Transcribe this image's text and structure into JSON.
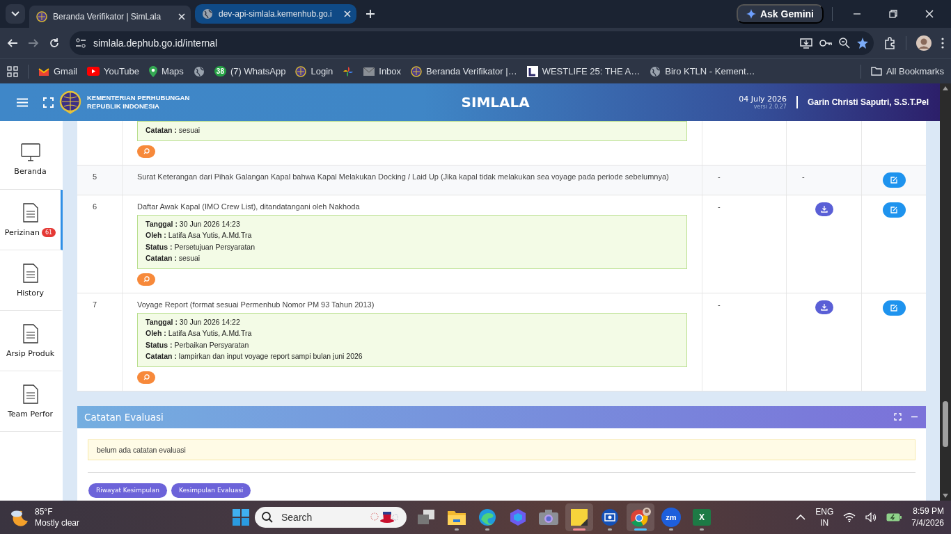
{
  "browser": {
    "tabs": [
      {
        "title": "Beranda Verifikator | SimLala",
        "kind": "emblem",
        "selected": true
      },
      {
        "title": "dev-api-simlala.kemenhub.go.i",
        "kind": "globe",
        "selected": false
      }
    ],
    "ask_gemini": "Ask Gemini",
    "url": "simlala.dephub.go.id/internal",
    "bookmarks": [
      {
        "kind": "gmail",
        "label": "Gmail"
      },
      {
        "kind": "youtube",
        "label": "YouTube"
      },
      {
        "kind": "maps",
        "label": "Maps"
      },
      {
        "kind": "globe"
      },
      {
        "kind": "whatsapp",
        "badge": "38",
        "label": "(7) WhatsApp"
      },
      {
        "kind": "emblem",
        "label": "Login"
      },
      {
        "kind": "pinwheel"
      },
      {
        "kind": "mail",
        "label": "Inbox"
      },
      {
        "kind": "emblem",
        "label": "Beranda Verifikator |…"
      },
      {
        "kind": "square",
        "label": "WESTLIFE 25: THE A…"
      },
      {
        "kind": "globe",
        "label": "Biro KTLN - Kement…"
      }
    ],
    "all_bookmarks": "All Bookmarks"
  },
  "app_header": {
    "ministry": [
      "KEMENTERIAN PERHUBUNGAN",
      "REPUBLIK INDONESIA"
    ],
    "title": "SIMLALA",
    "date": "04 July 2026",
    "version": "versi 2.0.27",
    "user": "Garin Christi Saputri, S.S.T.Pel"
  },
  "sidebar": {
    "items": [
      {
        "kind": "monitor",
        "label": "Beranda",
        "selected": false
      },
      {
        "kind": "document",
        "label": "Perizinan",
        "badge": "61",
        "selected": true
      },
      {
        "kind": "document",
        "label": "History",
        "selected": false
      },
      {
        "kind": "document",
        "label": "Arsip Produk",
        "selected": false
      },
      {
        "kind": "document",
        "label": "Team Perfor",
        "selected": false
      }
    ]
  },
  "table": {
    "rows": [
      {
        "notes": [
          {
            "label": "Catatan :",
            "value": "sesuai"
          }
        ],
        "view_button": true,
        "download": false,
        "edit": false
      },
      {
        "no": "5",
        "document": "Surat Keterangan dari Pihak Galangan Kapal bahwa Kapal Melakukan Docking / Laid Up (Jika kapal tidak melakukan sea voyage pada periode sebelumnya)",
        "column_3": "-",
        "column_4": "-",
        "view_button": false,
        "download": false,
        "edit": true
      },
      {
        "no": "6",
        "document": "Daftar Awak Kapal (IMO Crew List), ditandatangani oleh Nakhoda",
        "notes": [
          {
            "label": "Tanggal :",
            "value": "30 Jun 2026 14:23"
          },
          {
            "label": "Oleh :",
            "value": "Latifa Asa Yutis, A.Md.Tra"
          },
          {
            "label": "Status :",
            "value": "Persetujuan Persyaratan"
          },
          {
            "label": "Catatan :",
            "value": "sesuai"
          }
        ],
        "column_3": "-",
        "view_button": true,
        "download": true,
        "edit": true
      },
      {
        "no": "7",
        "document": "Voyage Report (format sesuai Permenhub Nomor PM 93 Tahun 2013)",
        "notes": [
          {
            "label": "Tanggal :",
            "value": "30 Jun 2026 14:22"
          },
          {
            "label": "Oleh :",
            "value": "Latifa Asa Yutis, A.Md.Tra"
          },
          {
            "label": "Status :",
            "value": "Perbaikan Persyaratan"
          },
          {
            "label": "Catatan :",
            "value": "lampirkan dan input voyage report sampi bulan juni 2026"
          }
        ],
        "column_3": "-",
        "view_button": true,
        "download": true,
        "edit": true
      }
    ]
  },
  "evaluation": {
    "title": "Catatan Evaluasi",
    "message": "belum ada catatan evaluasi",
    "buttons": [
      "Riwayat Kesimpulan",
      "Kesimpulan Evaluasi"
    ]
  },
  "taskbar": {
    "weather": {
      "temperature": "85°F",
      "condition": "Mostly clear"
    },
    "search_placeholder": "Search",
    "apps": [
      {
        "kind": "taskview",
        "running": false,
        "active": false
      },
      {
        "kind": "explorer",
        "running": true,
        "active": false
      },
      {
        "kind": "edge",
        "running": true,
        "active": false
      },
      {
        "kind": "copilot",
        "running": false,
        "active": false
      },
      {
        "kind": "camera",
        "running": false,
        "active": false
      },
      {
        "kind": "sticky",
        "running": true,
        "active": true
      },
      {
        "kind": "remote",
        "running": true,
        "active": false
      },
      {
        "kind": "chrome",
        "running": true,
        "active": true
      },
      {
        "kind": "zoom",
        "label": "zm",
        "running": true,
        "active": false
      },
      {
        "kind": "excel",
        "label": "X",
        "running": true,
        "active": false
      }
    ],
    "language": [
      "ENG",
      "IN"
    ],
    "time": "8:59 PM",
    "date": "7/4/2026"
  }
}
